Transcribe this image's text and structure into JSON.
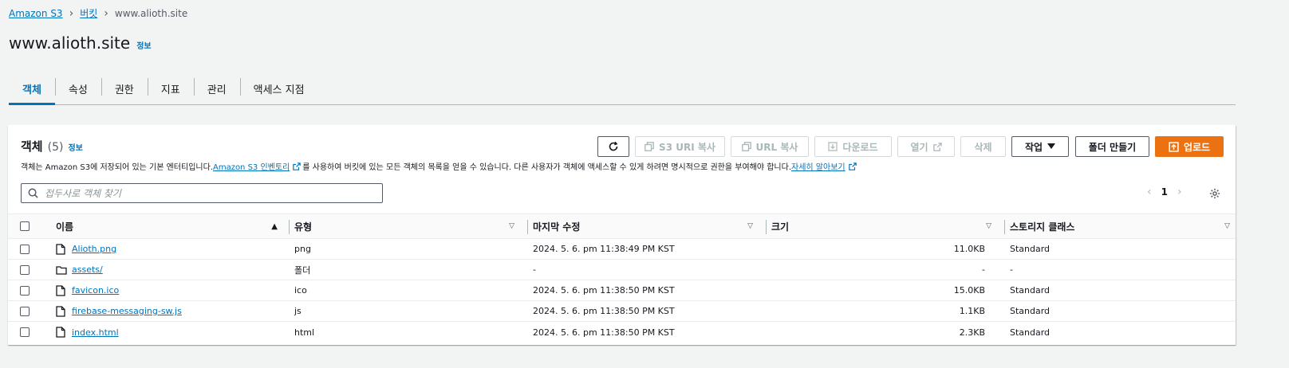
{
  "breadcrumb": {
    "items": [
      "Amazon S3",
      "버킷"
    ],
    "current": "www.alioth.site"
  },
  "header": {
    "title": "www.alioth.site",
    "info": "정보"
  },
  "tabs": [
    "객체",
    "속성",
    "권한",
    "지표",
    "관리",
    "액세스 지점"
  ],
  "panel": {
    "title": "객체",
    "count": "(5)",
    "info": "정보",
    "desc_part1": "객체는 Amazon S3에 저장되어 있는 기본 엔터티입니다. ",
    "desc_link1": "Amazon S3 인벤토리",
    "desc_part2": "를 사용하여 버킷에 있는 모든 객체의 목록을 얻을 수 있습니다. 다른 사용자가 객체에 액세스할 수 있게 하려면 명시적으로 권한을 부여해야 합니다. ",
    "desc_link2": "자세히 알아보기"
  },
  "actions": {
    "copy_s3_uri": "S3 URI 복사",
    "copy_url": "URL 복사",
    "download": "다운로드",
    "open": "열기",
    "delete": "삭제",
    "actions": "작업",
    "create_folder": "폴더 만들기",
    "upload": "업로드"
  },
  "search": {
    "placeholder": "접두사로 객체 찾기",
    "value": ""
  },
  "pagination": {
    "page": "1"
  },
  "table": {
    "columns": [
      "이름",
      "유형",
      "마지막 수정",
      "크기",
      "스토리지 클래스"
    ],
    "rows": [
      {
        "name": "Alioth.png",
        "kind": "file",
        "type": "png",
        "modified": "2024. 5. 6. pm 11:38:49 PM KST",
        "size": "11.0KB",
        "class": "Standard"
      },
      {
        "name": "assets/",
        "kind": "folder",
        "type": "폴더",
        "modified": "-",
        "size": "-",
        "class": "-"
      },
      {
        "name": "favicon.ico",
        "kind": "file",
        "type": "ico",
        "modified": "2024. 5. 6. pm 11:38:50 PM KST",
        "size": "15.0KB",
        "class": "Standard"
      },
      {
        "name": "firebase-messaging-sw.js",
        "kind": "file",
        "type": "js",
        "modified": "2024. 5. 6. pm 11:38:50 PM KST",
        "size": "1.1KB",
        "class": "Standard"
      },
      {
        "name": "index.html",
        "kind": "file",
        "type": "html",
        "modified": "2024. 5. 6. pm 11:38:50 PM KST",
        "size": "2.3KB",
        "class": "Standard"
      }
    ]
  },
  "colors": {
    "link": "#0073bb",
    "primary": "#ec7211",
    "background": "#f2f3f3"
  }
}
